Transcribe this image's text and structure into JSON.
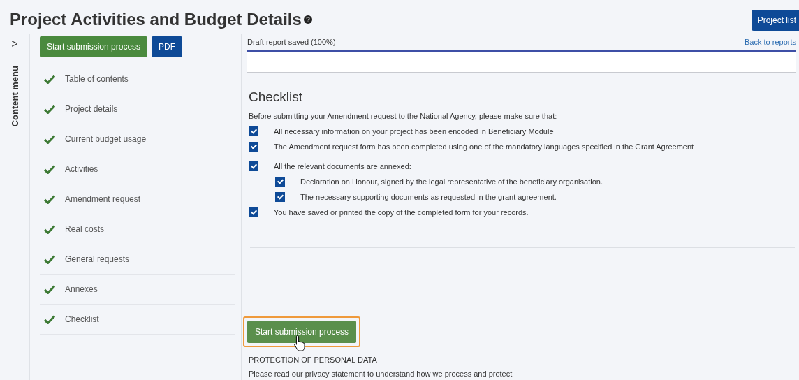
{
  "title": "Project Activities and Budget Details",
  "top_button": "Project list",
  "side_toggle": ">",
  "side_label": "Content menu",
  "sidebar": {
    "buttons": [
      {
        "label": "Start submission process",
        "kind": "primary"
      },
      {
        "label": "PDF",
        "kind": "secondary"
      }
    ],
    "items": [
      {
        "label": "Table of contents",
        "done": true
      },
      {
        "label": "Project details",
        "done": true
      },
      {
        "label": "Current budget usage",
        "done": true
      },
      {
        "label": "Activities",
        "done": true
      },
      {
        "label": "Amendment request",
        "done": true
      },
      {
        "label": "Real costs",
        "done": true
      },
      {
        "label": "General requests",
        "done": true
      },
      {
        "label": "Annexes",
        "done": true
      },
      {
        "label": "Checklist",
        "done": true
      }
    ]
  },
  "status": {
    "text": "Draft report saved (100%)",
    "level": 1,
    "link": "Back to reports"
  },
  "checklist": {
    "heading": "Checklist",
    "intro": "Before submitting your Amendment request to the National Agency, please make sure that:",
    "items": [
      {
        "label": "All necessary information on your project has been encoded in Beneficiary Module",
        "checked": true
      },
      {
        "label": "The Amendment request form has been completed using one of the mandatory languages specified in the Grant Agreement",
        "checked": true
      },
      {
        "label": "All the relevant documents are annexed:",
        "checked": true,
        "children": [
          {
            "label": "Declaration on Honour, signed by the legal representative of the beneficiary organisation.",
            "checked": true
          },
          {
            "label": "The necessary supporting documents as requested in the grant agreement.",
            "checked": true
          }
        ]
      },
      {
        "label": "You have saved or printed the copy of the completed form for your records.",
        "checked": true
      }
    ]
  },
  "submit_button": {
    "label": "Start submission process",
    "focused": true
  },
  "protection": {
    "heading": "PROTECTION OF PERSONAL DATA",
    "text": "Please read our privacy statement to understand how we process and protect"
  }
}
